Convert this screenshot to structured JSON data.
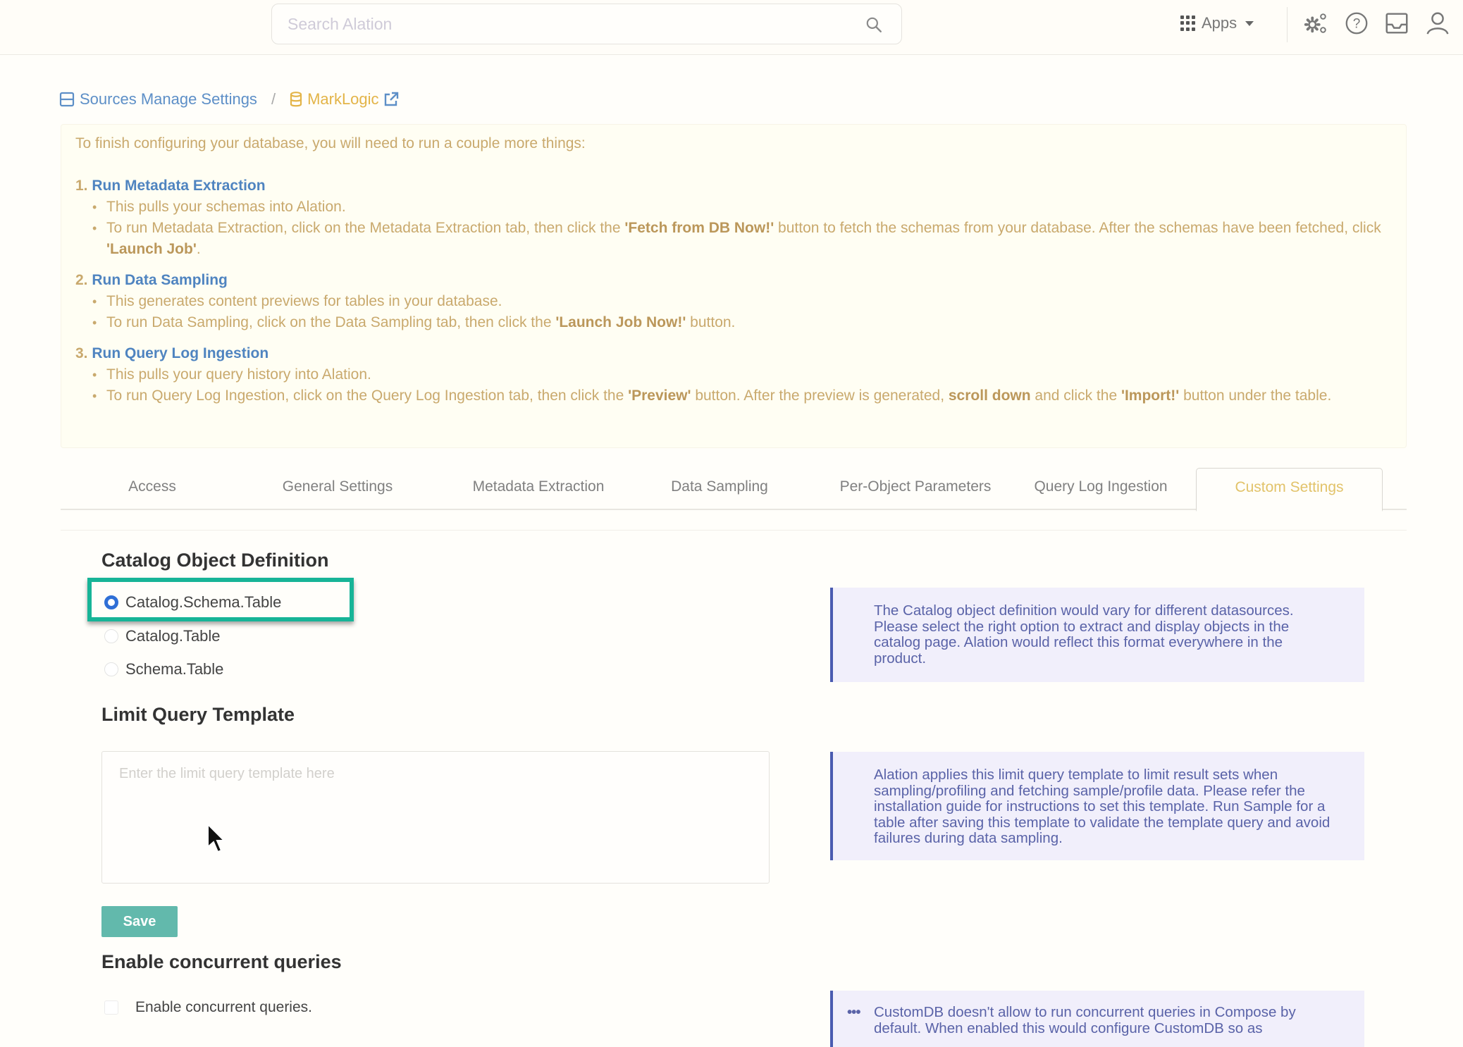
{
  "topbar": {
    "search_placeholder": "Search Alation",
    "search_icon": "magnifier-icon",
    "apps_label": "Apps",
    "icons": [
      "settings-gears-icon",
      "help-circle-icon",
      "inbox-icon",
      "user-icon"
    ]
  },
  "breadcrumb": {
    "root_label": "Sources Manage Settings",
    "separator": "/",
    "current_label": "MarkLogic",
    "colors": {
      "root": "#5d8fc7",
      "current": "#e3b448"
    }
  },
  "notice": {
    "intro": "To finish configuring your database, you will need to run a couple more things:",
    "steps": [
      {
        "num": "1.",
        "title": "Run Metadata Extraction",
        "bullets": [
          {
            "parts": [
              {
                "t": "This pulls your schemas into Alation."
              }
            ]
          },
          {
            "parts": [
              {
                "t": "To run Metadata Extraction, click on the Metadata Extraction tab, then click the "
              },
              {
                "t": "'Fetch from DB Now!'",
                "b": true
              },
              {
                "t": " button to fetch the schemas from your database. After the schemas have been fetched, click "
              },
              {
                "t": "'Launch Job'",
                "b": true
              },
              {
                "t": "."
              }
            ]
          }
        ]
      },
      {
        "num": "2.",
        "title": "Run Data Sampling",
        "bullets": [
          {
            "parts": [
              {
                "t": "This generates content previews for tables in your database."
              }
            ]
          },
          {
            "parts": [
              {
                "t": "To run Data Sampling, click on the Data Sampling tab, then click the "
              },
              {
                "t": "'Launch Job Now!'",
                "b": true
              },
              {
                "t": " button."
              }
            ]
          }
        ]
      },
      {
        "num": "3.",
        "title": "Run Query Log Ingestion",
        "bullets": [
          {
            "parts": [
              {
                "t": "This pulls your query history into Alation."
              }
            ]
          },
          {
            "parts": [
              {
                "t": "To run Query Log Ingestion, click on the Query Log Ingestion tab, then click the "
              },
              {
                "t": "'Preview'",
                "b": true
              },
              {
                "t": " button. After the preview is generated, "
              },
              {
                "t": "scroll down",
                "b": true
              },
              {
                "t": " and click the "
              },
              {
                "t": "'Import!'",
                "b": true
              },
              {
                "t": " button under the table."
              }
            ]
          }
        ]
      }
    ]
  },
  "tabs": [
    {
      "label": "Access",
      "active": false
    },
    {
      "label": "General Settings",
      "active": false
    },
    {
      "label": "Metadata Extraction",
      "active": false
    },
    {
      "label": "Data Sampling",
      "active": false
    },
    {
      "label": "Per-Object Parameters",
      "active": false
    },
    {
      "label": "Query Log Ingestion",
      "active": false
    },
    {
      "label": "Custom Settings",
      "active": true
    }
  ],
  "catalog_definition": {
    "heading": "Catalog Object Definition",
    "options": [
      {
        "label": "Catalog.Schema.Table",
        "selected": true
      },
      {
        "label": "Catalog.Table",
        "selected": false
      },
      {
        "label": "Schema.Table",
        "selected": false
      }
    ],
    "info": "The Catalog object definition would vary for different datasources. Please select the right option to extract and display objects in the catalog page. Alation would reflect this format everywhere in the product."
  },
  "limit_query": {
    "heading": "Limit Query Template",
    "value": "",
    "placeholder": "Enter the limit query template here",
    "info": "Alation applies this limit query template to limit result sets when sampling/profiling and fetching sample/profile data. Please refer the installation guide for instructions to set this template. Run Sample for a table after saving this template to validate the template query and avoid failures during data sampling."
  },
  "save_label": "Save",
  "concurrent": {
    "heading": "Enable concurrent queries",
    "checkbox_label": "Enable concurrent queries.",
    "checked": false,
    "info": "CustomDB doesn't allow to run concurrent queries in Compose by default. When enabled this would configure CustomDB so as"
  },
  "colors": {
    "accent_teal": "#17b497",
    "save_button": "#62b9ac",
    "link_blue": "#4f84c0",
    "notice_text": "#c9a96d",
    "active_tab": "#e2c36a",
    "info_border": "#4a5bb0",
    "info_bg": "#f1effb"
  }
}
